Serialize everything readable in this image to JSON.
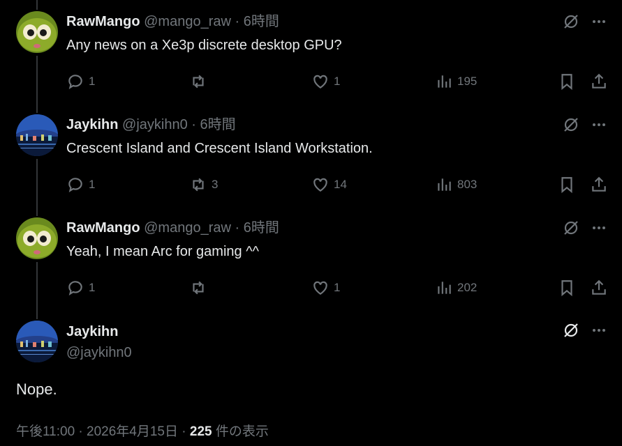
{
  "tweets": [
    {
      "name": "RawMango",
      "handle": "@mango_raw",
      "sep": " · ",
      "time": "6時間",
      "text": "Any news on a Xe3p discrete desktop GPU?",
      "replies": "1",
      "retweets": "",
      "likes": "1",
      "views": "195",
      "avatar": "mango"
    },
    {
      "name": "Jaykihn",
      "handle": "@jaykihn0",
      "sep": " · ",
      "time": "6時間",
      "text": "Crescent Island and Crescent Island Workstation.",
      "replies": "1",
      "retweets": "3",
      "likes": "14",
      "views": "803",
      "avatar": "city"
    },
    {
      "name": "RawMango",
      "handle": "@mango_raw",
      "sep": " · ",
      "time": "6時間",
      "text": "Yeah, I mean Arc for gaming ^^",
      "replies": "1",
      "retweets": "",
      "likes": "1",
      "views": "202",
      "avatar": "mango"
    }
  ],
  "main": {
    "name": "Jaykihn",
    "handle": "@jaykihn0",
    "text": "Nope.",
    "timestamp": "午後11:00 · 2026年4月15日 · ",
    "view_count": "225",
    "view_label": " 件の表示"
  },
  "icons": {
    "grok": "grok-icon",
    "more": "more-icon",
    "reply": "reply-icon",
    "retweet": "retweet-icon",
    "like": "heart-icon",
    "views": "views-icon",
    "bookmark": "bookmark-icon",
    "share": "share-icon"
  },
  "colors": {
    "background": "#000000",
    "text": "#e7e9ea",
    "muted": "#71767b",
    "line": "#333639"
  }
}
